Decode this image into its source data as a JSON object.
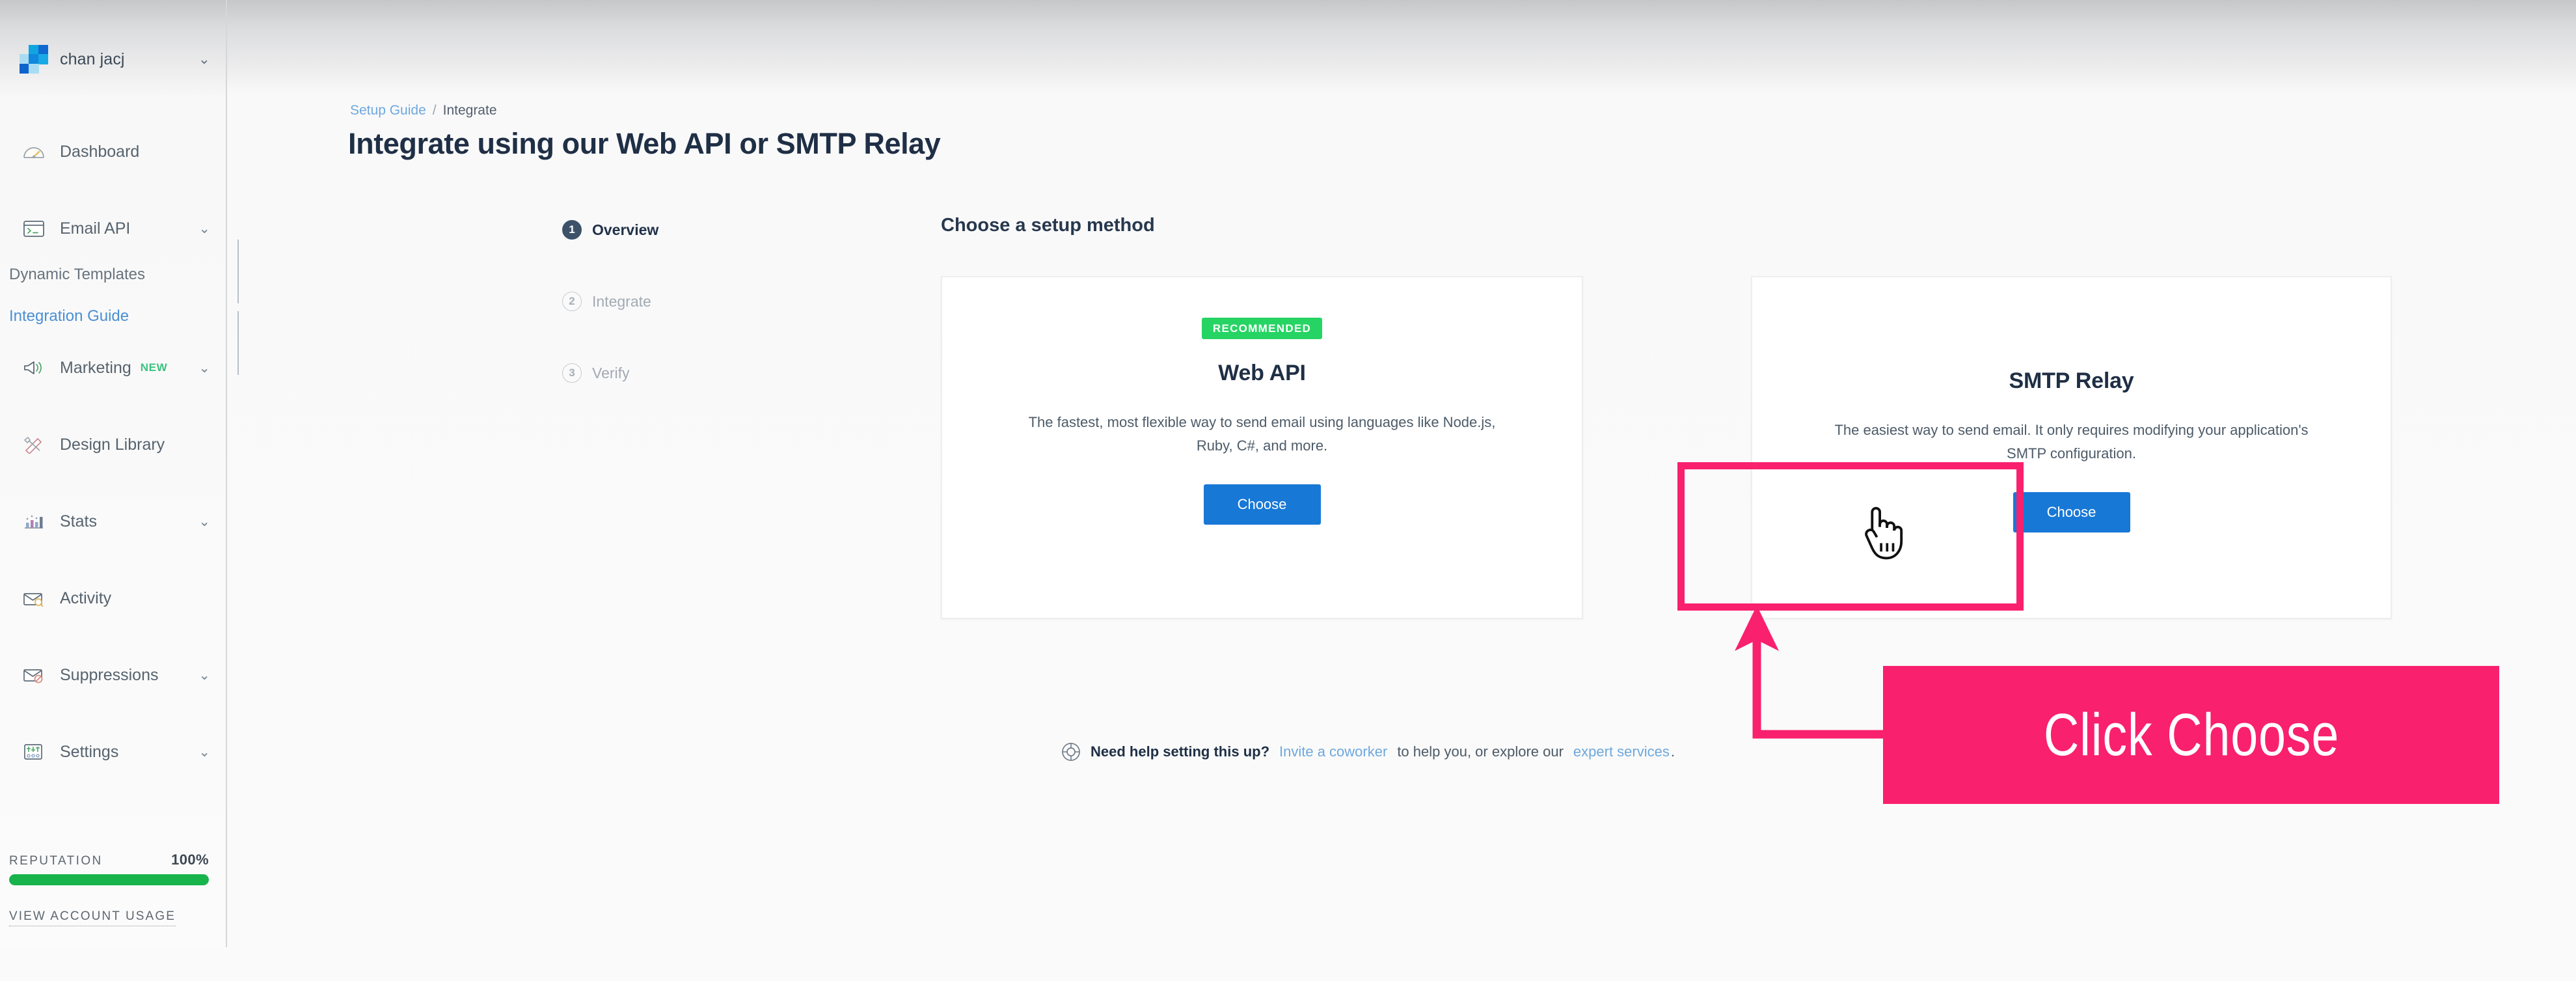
{
  "sidebar": {
    "account": {
      "name": "chan jacj",
      "caret": "chevron-down-icon"
    },
    "items": [
      {
        "label": "Dashboard",
        "icon": "dashboard-gauge-icon",
        "caret": false,
        "badge": ""
      },
      {
        "label": "Email API",
        "icon": "terminal-icon",
        "caret": true,
        "badge": ""
      },
      {
        "label": "Marketing",
        "icon": "megaphone-icon",
        "caret": true,
        "badge": "NEW"
      },
      {
        "label": "Design Library",
        "icon": "design-tools-icon",
        "caret": true,
        "badge": ""
      },
      {
        "label": "Stats",
        "icon": "bar-chart-icon",
        "caret": true,
        "badge": ""
      },
      {
        "label": "Activity",
        "icon": "envelope-search-icon",
        "caret": false,
        "badge": ""
      },
      {
        "label": "Suppressions",
        "icon": "envelope-blocked-icon",
        "caret": true,
        "badge": ""
      },
      {
        "label": "Settings",
        "icon": "sliders-icon",
        "caret": true,
        "badge": ""
      }
    ],
    "sub_items": [
      {
        "label": "Dynamic Templates",
        "active": false
      },
      {
        "label": "Integration Guide",
        "active": true
      }
    ],
    "reputation": {
      "label": "REPUTATION",
      "percent": "100%",
      "fill": 100,
      "bar_color": "#18b34b"
    },
    "account_usage_link": "VIEW ACCOUNT USAGE"
  },
  "breadcrumb": {
    "root": "Setup Guide",
    "separator": "/",
    "current": "Integrate"
  },
  "page": {
    "title": "Integrate using our Web API or SMTP Relay",
    "section_heading": "Choose a setup method"
  },
  "stepper": {
    "steps": [
      {
        "num": "1",
        "label": "Overview",
        "state": "active"
      },
      {
        "num": "2",
        "label": "Integrate",
        "state": "idle"
      },
      {
        "num": "3",
        "label": "Verify",
        "state": "idle"
      }
    ]
  },
  "cards": [
    {
      "badge": "RECOMMENDED",
      "title": "Web API",
      "description": "The fastest, most flexible way to send email using languages like Node.js, Ruby, C#, and more.",
      "button": "Choose"
    },
    {
      "badge": "",
      "title": "SMTP Relay",
      "description": "The easiest way to send email. It only requires modifying your application's SMTP configuration.",
      "button": "Choose"
    }
  ],
  "help": {
    "icon": "lifesaver-icon",
    "prefix": "Need help setting this up?",
    "link1": "Invite a coworker",
    "middle": "to help you, or explore our",
    "link2": "expert services",
    "suffix": "."
  },
  "annotation": {
    "callout_text": "Click Choose",
    "accent_color": "#f9206e",
    "cursor": "pointing-hand-cursor"
  },
  "colors": {
    "primary_button": "#1878d6",
    "recommended_badge": "#26d464",
    "link": "#6ea8dd",
    "title": "#1f2f45"
  }
}
